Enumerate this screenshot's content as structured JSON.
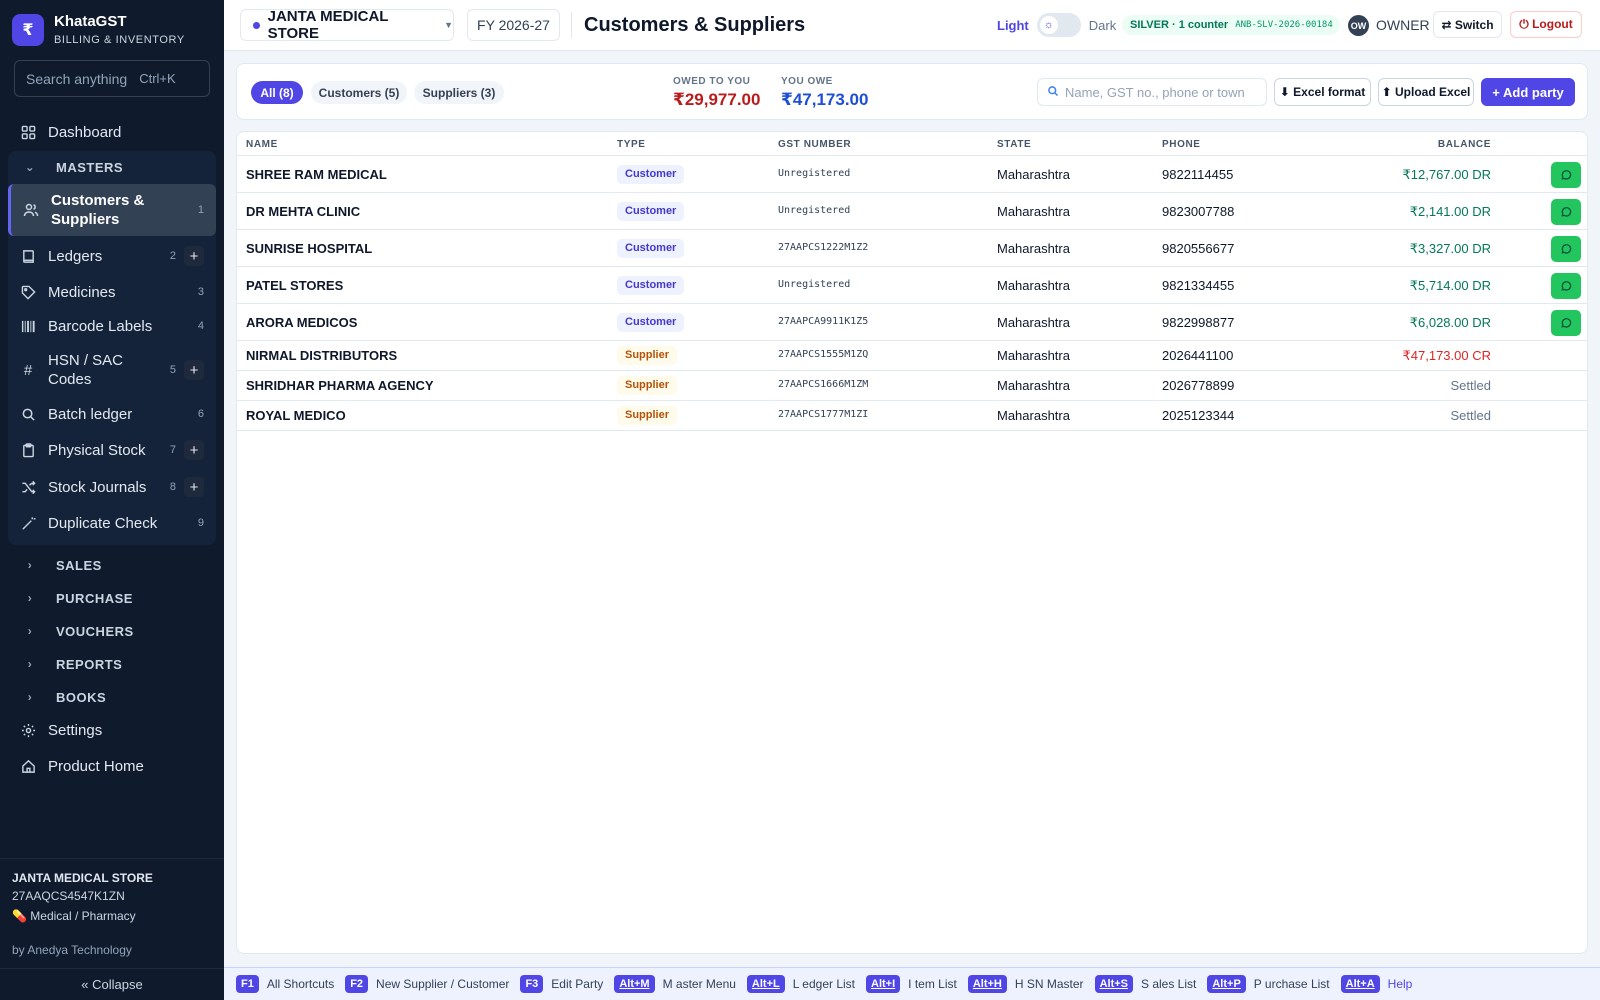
{
  "brand": {
    "logo": "₹",
    "name": "KhataGST",
    "subtitle": "BILLING & INVENTORY"
  },
  "sidebar": {
    "search_placeholder": "Search anything",
    "search_shortcut": "Ctrl+K",
    "dashboard": "Dashboard",
    "masters_label": "MASTERS",
    "masters_items": [
      {
        "label": "Customers & Suppliers",
        "num": "1",
        "icon": "users-icon"
      },
      {
        "label": "Ledgers",
        "num": "2",
        "icon": "book-icon",
        "plus": "+"
      },
      {
        "label": "Medicines",
        "num": "3",
        "icon": "tag-icon"
      },
      {
        "label": "Barcode Labels",
        "num": "4",
        "icon": "barcode-icon"
      },
      {
        "label": "HSN / SAC Codes",
        "num": "5",
        "icon": "hash-icon",
        "plus": "+"
      },
      {
        "label": "Batch ledger",
        "num": "6",
        "icon": "search-icon"
      },
      {
        "label": "Physical Stock",
        "num": "7",
        "icon": "clipboard-icon",
        "plus": "+"
      },
      {
        "label": "Stock Journals",
        "num": "8",
        "icon": "shuffle-icon",
        "plus": "+"
      },
      {
        "label": "Duplicate Check",
        "num": "9",
        "icon": "wand-icon"
      }
    ],
    "sections": [
      "SALES",
      "PURCHASE",
      "VOUCHERS",
      "REPORTS",
      "BOOKS"
    ],
    "settings": "Settings",
    "product_home": "Product Home",
    "footer": {
      "company": "JANTA MEDICAL STORE",
      "gst": "27AAQCS4547K1ZN",
      "business_icon": "💊",
      "business_type": "Medical / Pharmacy",
      "by": "by Anedya Technology",
      "collapse": "« Collapse"
    }
  },
  "header": {
    "company": "JANTA MEDICAL STORE",
    "fy": "FY 2026-27",
    "title": "Customers & Suppliers",
    "theme_light": "Light",
    "theme_dark": "Dark",
    "plan": "SILVER · 1 counter",
    "plan_code": "ANB-SLV-2026-00184",
    "avatar": "OW",
    "role": "OWNER",
    "switch": "⇄ Switch",
    "logout": "⏻ Logout"
  },
  "toolbar": {
    "filters": {
      "all": "All (8)",
      "customers": "Customers (5)",
      "suppliers": "Suppliers (3)"
    },
    "owed_label": "OWED TO YOU",
    "owed_value": "₹29,977.00",
    "owe_label": "YOU OWE",
    "owe_value": "₹47,173.00",
    "search_placeholder": "Name, GST no., phone or town",
    "excel_format": "⬇ Excel format",
    "upload_excel": "⬆ Upload Excel",
    "add_party": "+ Add party"
  },
  "table": {
    "columns": [
      "NAME",
      "TYPE",
      "GST NUMBER",
      "STATE",
      "PHONE",
      "BALANCE"
    ],
    "rows": [
      {
        "name": "SHREE RAM MEDICAL",
        "type": "Customer",
        "gst": "Unregistered",
        "state": "Maharashtra",
        "phone": "9822114455",
        "balance": "₹12,767.00 DR",
        "status": "dr",
        "whatsapp": true
      },
      {
        "name": "DR MEHTA CLINIC",
        "type": "Customer",
        "gst": "Unregistered",
        "state": "Maharashtra",
        "phone": "9823007788",
        "balance": "₹2,141.00 DR",
        "status": "dr",
        "whatsapp": true
      },
      {
        "name": "SUNRISE HOSPITAL",
        "type": "Customer",
        "gst": "27AAPCS1222M1Z2",
        "state": "Maharashtra",
        "phone": "9820556677",
        "balance": "₹3,327.00 DR",
        "status": "dr",
        "whatsapp": true
      },
      {
        "name": "PATEL STORES",
        "type": "Customer",
        "gst": "Unregistered",
        "state": "Maharashtra",
        "phone": "9821334455",
        "balance": "₹5,714.00 DR",
        "status": "dr",
        "whatsapp": true
      },
      {
        "name": "ARORA MEDICOS",
        "type": "Customer",
        "gst": "27AAPCA9911K1Z5",
        "state": "Maharashtra",
        "phone": "9822998877",
        "balance": "₹6,028.00 DR",
        "status": "dr",
        "whatsapp": true
      },
      {
        "name": "NIRMAL DISTRIBUTORS",
        "type": "Supplier",
        "gst": "27AAPCS1555M1ZQ",
        "state": "Maharashtra",
        "phone": "2026441100",
        "balance": "₹47,173.00 CR",
        "status": "cr",
        "whatsapp": false
      },
      {
        "name": "SHRIDHAR PHARMA AGENCY",
        "type": "Supplier",
        "gst": "27AAPCS1666M1ZM",
        "state": "Maharashtra",
        "phone": "2026778899",
        "balance": "Settled",
        "status": "settled",
        "whatsapp": false
      },
      {
        "name": "ROYAL MEDICO",
        "type": "Supplier",
        "gst": "27AAPCS1777M1ZI",
        "state": "Maharashtra",
        "phone": "2025123344",
        "balance": "Settled",
        "status": "settled",
        "whatsapp": false
      }
    ]
  },
  "shortcuts": [
    {
      "key": "F1",
      "label": "All Shortcuts"
    },
    {
      "key": "F2",
      "label": "New Supplier / Customer"
    },
    {
      "key": "F3",
      "label": "Edit Party"
    },
    {
      "key": "Alt+M",
      "label": "M aster Menu"
    },
    {
      "key": "Alt+L",
      "label": "L edger List"
    },
    {
      "key": "Alt+I",
      "label": "I tem List"
    },
    {
      "key": "Alt+H",
      "label": "H SN Master"
    },
    {
      "key": "Alt+S",
      "label": "S ales List"
    },
    {
      "key": "Alt+P",
      "label": "P urchase List"
    },
    {
      "key": "Alt+A",
      "label": "Help"
    }
  ]
}
